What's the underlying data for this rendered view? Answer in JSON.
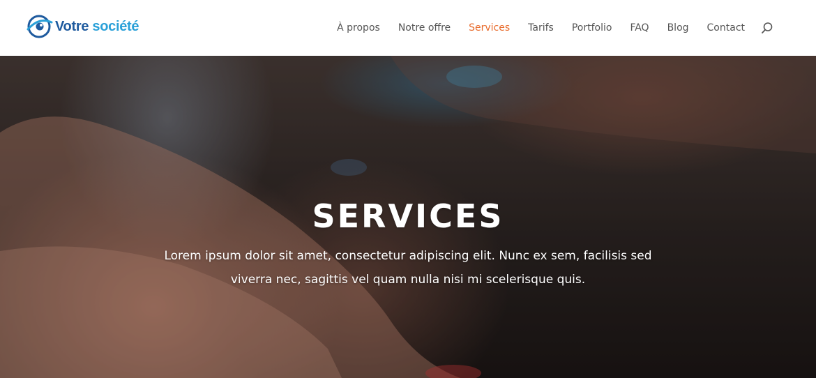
{
  "colors": {
    "accent": "#e86a2a",
    "nav_text": "#555555",
    "brand_dark": "#1e5a9e",
    "brand_light": "#2aa0d8",
    "hero_text": "#ffffff"
  },
  "header": {
    "logo": {
      "icon": "company-logo-icon",
      "text_main": "Votre ",
      "text_accent": "société"
    },
    "nav": {
      "items": [
        {
          "label": "À propos"
        },
        {
          "label": "Notre offre"
        },
        {
          "label": "Services",
          "active": true
        },
        {
          "label": "Tarifs"
        },
        {
          "label": "Portfolio"
        },
        {
          "label": "FAQ"
        },
        {
          "label": "Blog"
        },
        {
          "label": "Contact"
        }
      ],
      "search_icon": "search-icon"
    }
  },
  "hero": {
    "title": "SERVICES",
    "description": "Lorem ipsum dolor sit amet, consectetur adipiscing elit. Nunc ex sem, facilisis sed viverra nec, sagittis vel quam nulla nisi mi scelerisque quis.",
    "background": "blurred-photo-of-hands-at-workstation"
  }
}
